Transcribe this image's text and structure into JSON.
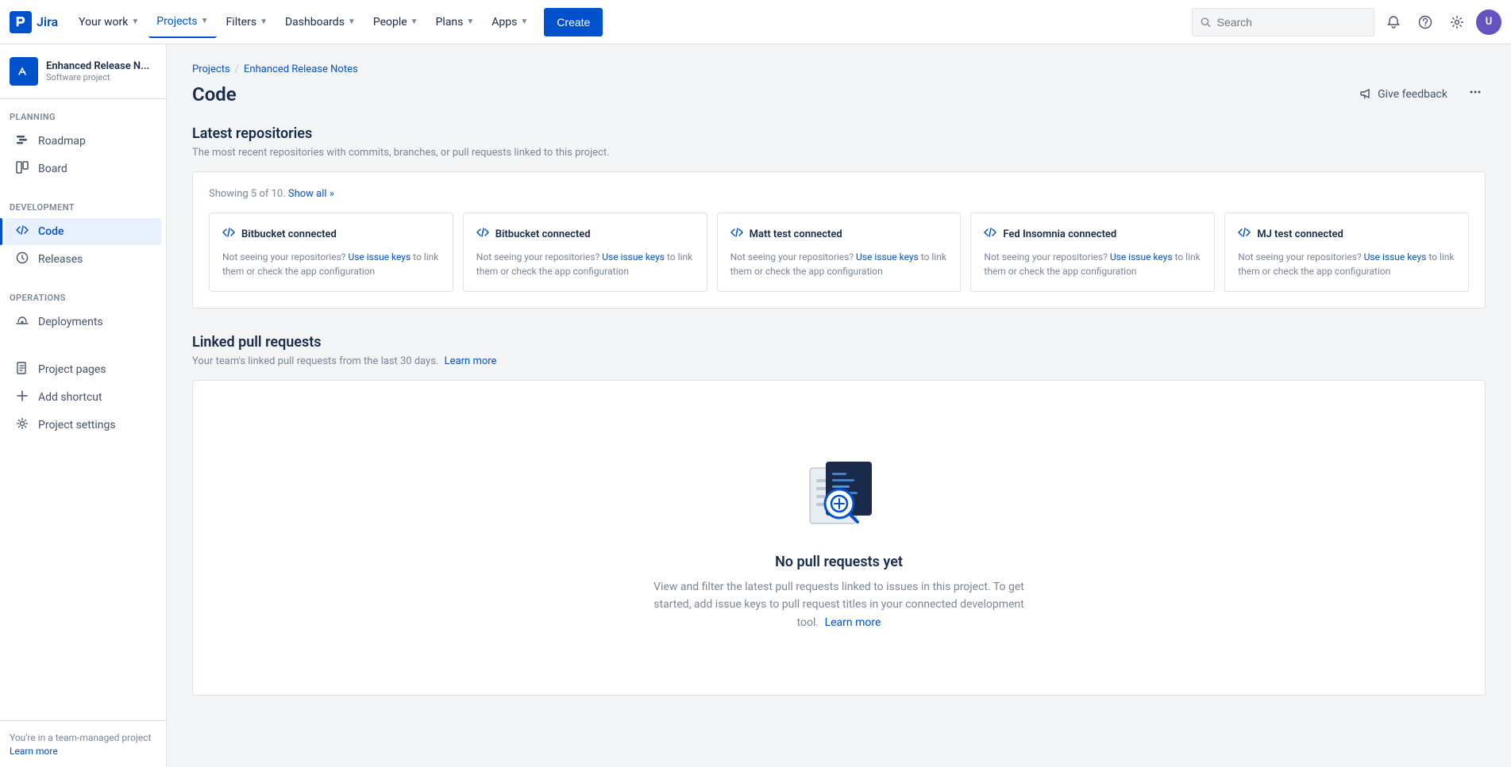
{
  "topnav": {
    "logo_text": "Jira",
    "nav_items": [
      {
        "label": "Your work",
        "chevron": true,
        "active": false
      },
      {
        "label": "Projects",
        "chevron": true,
        "active": true
      },
      {
        "label": "Filters",
        "chevron": true,
        "active": false
      },
      {
        "label": "Dashboards",
        "chevron": true,
        "active": false
      },
      {
        "label": "People",
        "chevron": true,
        "active": false
      },
      {
        "label": "Plans",
        "chevron": true,
        "active": false
      },
      {
        "label": "Apps",
        "chevron": true,
        "active": false
      }
    ],
    "create_label": "Create",
    "search_placeholder": "Search"
  },
  "sidebar": {
    "project_name": "Enhanced Release N...",
    "project_type": "Software project",
    "planning_label": "PLANNING",
    "planning_items": [
      {
        "label": "Roadmap",
        "icon": "📍"
      },
      {
        "label": "Board",
        "icon": "⬜"
      }
    ],
    "development_label": "DEVELOPMENT",
    "development_items": [
      {
        "label": "Code",
        "icon": "</>",
        "active": true
      },
      {
        "label": "Releases",
        "icon": "🚀"
      }
    ],
    "operations_label": "OPERATIONS",
    "operations_items": [
      {
        "label": "Deployments",
        "icon": "☁"
      }
    ],
    "other_items": [
      {
        "label": "Project pages",
        "icon": "📄"
      },
      {
        "label": "Add shortcut",
        "icon": "+"
      },
      {
        "label": "Project settings",
        "icon": "⚙"
      }
    ],
    "bottom_text": "You're in a team-managed project",
    "bottom_link": "Learn more"
  },
  "breadcrumb": {
    "items": [
      "Projects",
      "Enhanced Release Notes"
    ],
    "separator": "/"
  },
  "page": {
    "title": "Code",
    "feedback_label": "Give feedback",
    "more_label": "..."
  },
  "repos_section": {
    "title": "Latest repositories",
    "subtitle": "The most recent repositories with commits, branches, or pull requests linked to this project.",
    "showing_text": "Showing 5 of 10.",
    "show_all_label": "Show all »",
    "repos": [
      {
        "title": "Bitbucket connected",
        "body_prefix": "Not seeing your repositories?",
        "link_text": "Use issue keys",
        "body_suffix": "to link them or check the app configuration"
      },
      {
        "title": "Bitbucket connected",
        "body_prefix": "Not seeing your repositories?",
        "link_text": "Use issue keys",
        "body_suffix": "to link them or check the app configuration"
      },
      {
        "title": "Matt test connected",
        "body_prefix": "Not seeing your repositories?",
        "link_text": "Use issue keys",
        "body_suffix": "to link them or check the app configuration"
      },
      {
        "title": "Fed Insomnia connected",
        "body_prefix": "Not seeing your repositories?",
        "link_text": "Use issue keys",
        "body_suffix": "to link them or check the app configuration"
      },
      {
        "title": "MJ test connected",
        "body_prefix": "Not seeing your repositories?",
        "link_text": "Use issue keys",
        "body_suffix": "to link them or check the app configuration"
      }
    ]
  },
  "pull_requests_section": {
    "title": "Linked pull requests",
    "subtitle_text": "Your team's linked pull requests from the last 30 days.",
    "subtitle_link": "Learn more",
    "empty_title": "No pull requests yet",
    "empty_description": "View and filter the latest pull requests linked to issues in this project. To get started, add issue keys to pull request titles in your connected development tool.",
    "empty_link": "Learn more"
  },
  "colors": {
    "brand_blue": "#0052cc",
    "active_bg": "#e8f0fe",
    "border": "#dfe1e6",
    "text_secondary": "#7a869a",
    "text_primary": "#172b4d"
  }
}
